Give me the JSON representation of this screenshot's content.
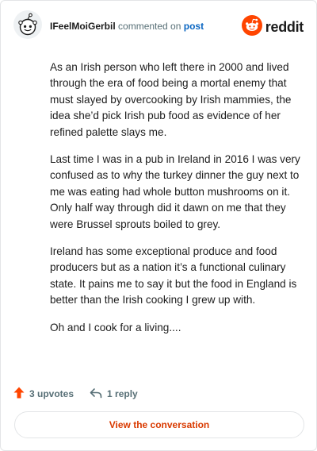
{
  "header": {
    "username": "IFeelMoiGerbil",
    "commented_on": "commented on",
    "post_link": "post",
    "brand": "reddit"
  },
  "comment": {
    "paragraphs": [
      "As an Irish person who left there in 2000 and lived through the era of food being a mortal enemy that must slayed by overcooking by Irish mammies, the idea she’d pick Irish pub food as evidence of her refined palette slays me.",
      "Last time I was in a pub in Ireland in 2016 I was very confused as to why the turkey dinner the guy next to me was eating had whole button mushrooms on it. Only half way through did it dawn on me that they were Brussel sprouts boiled to grey.",
      "Ireland has some exceptional produce and food producers but as a nation it’s a functional culinary state. It pains me to say it but the food in England is better than the Irish cooking I grew up with.",
      "Oh and I cook for a living...."
    ]
  },
  "actions": {
    "upvotes": "3 upvotes",
    "replies": "1 reply"
  },
  "view_button": "View the conversation",
  "colors": {
    "brand_orange": "#ff4500",
    "upvote_orange": "#ff4500",
    "link_blue": "#0a66c2",
    "button_text": "#d93a00",
    "meta_gray": "#576f76"
  },
  "icons": {
    "avatar": "snoo-avatar-icon",
    "logo": "reddit-logo-icon",
    "upvote": "upvote-arrow-icon",
    "reply": "reply-arrow-icon"
  }
}
